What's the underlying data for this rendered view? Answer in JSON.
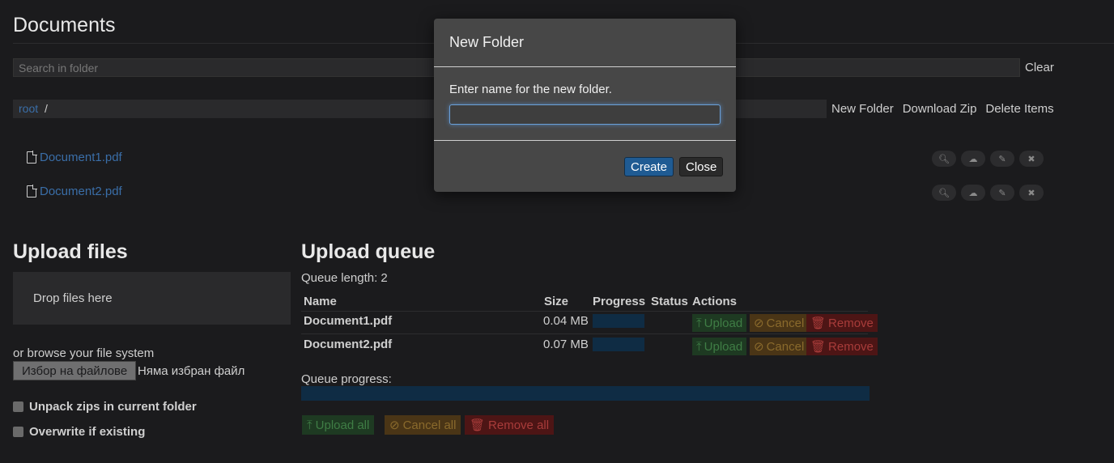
{
  "documents": {
    "title": "Documents",
    "search_placeholder": "Search in folder",
    "search_value": "",
    "clear_label": "Clear",
    "breadcrumb": {
      "root": "root",
      "separator": "/"
    },
    "toolbar": {
      "new_folder": "New Folder",
      "download_zip": "Download Zip",
      "delete_items": "Delete Items"
    },
    "files": [
      {
        "name": "Document1.pdf",
        "actions": [
          "search-icon",
          "cloud-download-icon",
          "pencil-icon",
          "close-icon"
        ]
      },
      {
        "name": "Document2.pdf",
        "actions": [
          "search-icon",
          "cloud-download-icon",
          "pencil-icon",
          "close-icon"
        ]
      }
    ]
  },
  "upload_files": {
    "title": "Upload files",
    "drop_zone": "Drop files here",
    "browse_label": "or browse your file system",
    "file_button": "Избор на файлове",
    "no_file": "Няма избран файл",
    "unpack_zips": "Unpack zips in current folder",
    "overwrite": "Overwrite if existing"
  },
  "upload_queue": {
    "title": "Upload queue",
    "queue_length": "Queue length: 2",
    "headers": {
      "name": "Name",
      "size": "Size",
      "progress": "Progress",
      "status": "Status",
      "actions": "Actions"
    },
    "items": [
      {
        "name": "Document1.pdf",
        "size": "0.04 MB",
        "progress": 0
      },
      {
        "name": "Document2.pdf",
        "size": "0.07 MB",
        "progress": 0
      }
    ],
    "item_buttons": {
      "upload": "Upload",
      "cancel": "Cancel",
      "remove": "Remove"
    },
    "queue_progress_label": "Queue progress:",
    "queue_progress": 0,
    "bulk_buttons": {
      "upload_all": "Upload all",
      "cancel_all": "Cancel all",
      "remove_all": "Remove all"
    }
  },
  "modal": {
    "title": "New Folder",
    "text": "Enter name for the new folder.",
    "input_value": "",
    "create": "Create",
    "close": "Close"
  },
  "colors": {
    "accent": "#1f5b93",
    "link": "#3a6ea8",
    "background": "#1b1b1d"
  }
}
